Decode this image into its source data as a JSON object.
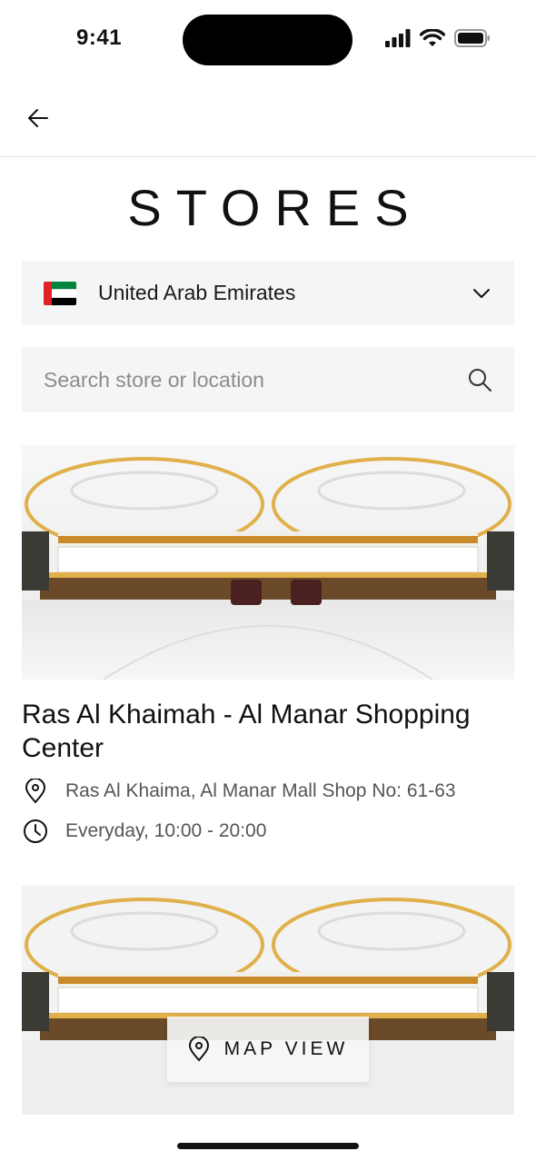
{
  "status_bar": {
    "time": "9:41"
  },
  "header": {
    "back_icon": "arrow-left-icon"
  },
  "page": {
    "title": "STORES"
  },
  "country_select": {
    "value": "United Arab Emirates",
    "flag_icon": "uae-flag-icon",
    "chevron_icon": "chevron-down-icon"
  },
  "search": {
    "placeholder": "Search store or location",
    "icon": "search-icon"
  },
  "stores": [
    {
      "name": "Ras Al Khaimah - Al Manar Shopping Center",
      "address": "Ras Al Khaima, Al Manar Mall Shop No: 61-63",
      "hours": "Everyday, 10:00 - 20:00",
      "address_icon": "location-pin-icon",
      "hours_icon": "clock-icon"
    },
    {
      "name": "",
      "address": "",
      "hours": ""
    }
  ],
  "map_view": {
    "label": "MAP VIEW",
    "icon": "location-pin-icon"
  },
  "colors": {
    "field_bg": "#f4f5f6",
    "text": "#111111",
    "muted": "#555555",
    "accent_gold": "#d9a23a"
  }
}
